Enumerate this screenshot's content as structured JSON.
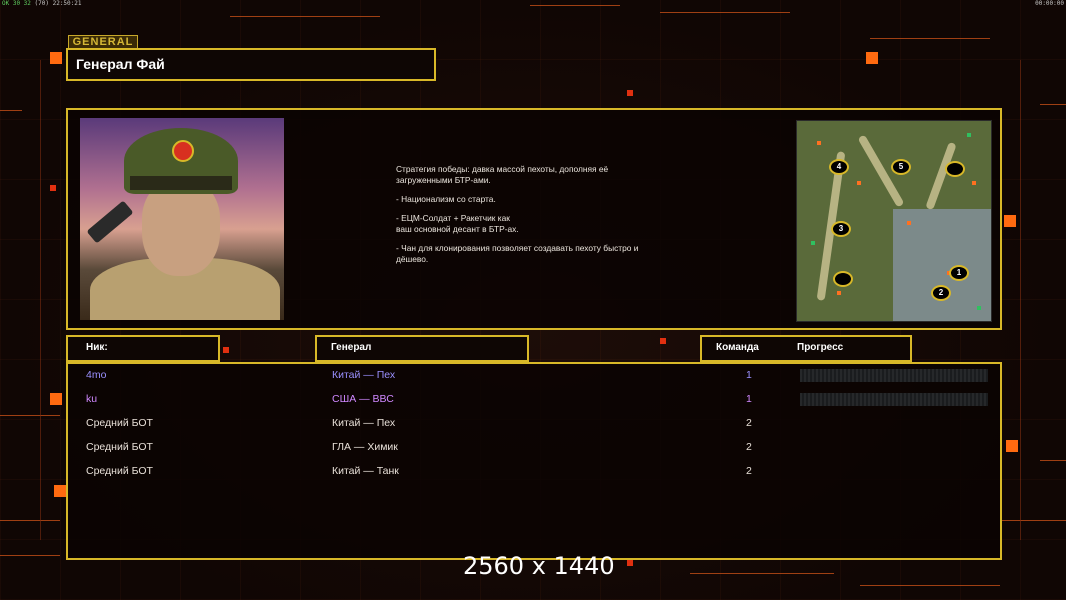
{
  "topbar": {
    "status_hl": "OK 30 32",
    "status_rest": "(70) 22:50:21",
    "clock_right": "00:00:00"
  },
  "brand": {
    "label": "GENERAL"
  },
  "general": {
    "name": "Генерал Фай"
  },
  "briefing": [
    "Стратегия победы: давка массой пехоты, дополняя её\n загруженными БТР-ами.",
    "- Национализм со старта.",
    "- ЕЦМ-Солдат + Ракетчик как\nваш основной десант в БТР-ах.",
    "- Чан для клонирования позволяет создавать пехоту быстро и\n дёшево."
  ],
  "map": {
    "start_positions": [
      "4",
      "5",
      "",
      "3",
      "",
      "1",
      "2"
    ]
  },
  "table": {
    "headers": {
      "nick": "Ник:",
      "general": "Генерал",
      "team": "Команда",
      "progress": "Прогресс"
    },
    "rows": [
      {
        "nick": "4mo",
        "general": "Китай — Пех",
        "team": "1",
        "color": "#9a90ff",
        "progress_bar": true
      },
      {
        "nick": "ku",
        "general": "США — ВВС",
        "team": "1",
        "color": "#d088ff",
        "progress_bar": true
      },
      {
        "nick": "Средний БОТ",
        "general": "Китай — Пех",
        "team": "2",
        "color": "#e8e0d8",
        "progress_bar": false
      },
      {
        "nick": "Средний БОТ",
        "general": "ГЛА — Химик",
        "team": "2",
        "color": "#e8e0d8",
        "progress_bar": false
      },
      {
        "nick": "Средний БОТ",
        "general": "Китай — Танк",
        "team": "2",
        "color": "#e8e0d8",
        "progress_bar": false
      }
    ]
  },
  "overlay": {
    "resolution": "2560 x 1440"
  },
  "colors": {
    "accent_gold": "#d8b828",
    "accent_orange": "#ff6a10",
    "background": "#120806"
  }
}
